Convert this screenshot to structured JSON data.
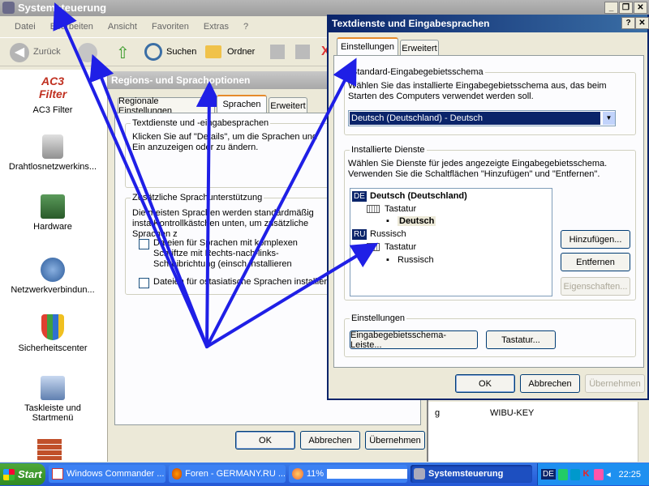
{
  "main_window": {
    "title": "Systemsteuerung",
    "menu": [
      "Datei",
      "Bearbeiten",
      "Ansicht",
      "Favoriten",
      "Extras",
      "?"
    ],
    "toolbar": {
      "back": "Zurück",
      "search": "Suchen",
      "folders": "Ordner"
    }
  },
  "sidebar": {
    "items": [
      {
        "label": "AC3 Filter",
        "icon": "ac3-filter-icon"
      },
      {
        "label": "Drahtlosnetzwerkins...",
        "icon": "wireless-network-icon"
      },
      {
        "label": "Hardware",
        "icon": "hardware-icon"
      },
      {
        "label": "Netzwerkverbindun...",
        "icon": "network-connections-icon"
      },
      {
        "label": "Sicherheitscenter",
        "icon": "security-center-icon"
      },
      {
        "label": "Taskleiste und Startmenü",
        "icon": "taskbar-icon"
      }
    ]
  },
  "regional_dialog": {
    "title": "Regions- und Sprachoptionen",
    "tabs": [
      "Regionale Einstellungen",
      "Sprachen",
      "Erweitert"
    ],
    "active_tab": "Sprachen",
    "group1_title": "Textdienste und -eingabesprachen",
    "group1_text": "Klicken Sie auf \"Details\", um die Sprachen und Ein anzuzeigen oder zu ändern.",
    "group2_title": "Zusätzliche Sprachunterstützung",
    "group2_text": "Die meisten Sprachen werden standardmäßig insta Kontrollkästchen unten, um zusätzliche Sprachen z",
    "checkbox1": "Dateien für Sprachen mit komplexen Schriftze mit Rechts-nach-links-Schreibrichtung (einsch installieren",
    "checkbox2": "Dateien für ostasiatische Sprachen installieren",
    "ok": "OK",
    "cancel": "Abbrechen",
    "apply": "Übernehmen"
  },
  "text_dialog": {
    "title": "Textdienste und Eingabesprachen",
    "help": "?",
    "close": "✕",
    "tabs": [
      "Einstellungen",
      "Erweitert"
    ],
    "std_group_title": "Standard-Eingabegebietsschema",
    "std_text": "Wählen Sie das installierte Eingabegebietsschema aus, das beim Starten des Computers verwendet werden soll.",
    "std_value": "Deutsch (Deutschland) - Deutsch",
    "installed_group_title": "Installierte Dienste",
    "installed_text": "Wählen Sie Dienste für jedes angezeigte Eingabegebietsschema. Verwenden Sie die Schaltflächen \"Hinzufügen\" und \"Entfernen\".",
    "tree": {
      "de_badge": "DE",
      "de_label": "Deutsch (Deutschland)",
      "de_kb": "Tastatur",
      "de_kb_item": "Deutsch",
      "ru_badge": "RU",
      "ru_label": "Russisch",
      "ru_kb": "Tastatur",
      "ru_kb_item": "Russisch"
    },
    "add": "Hinzufügen...",
    "remove": "Entfernen",
    "props": "Eigenschaften...",
    "settings_group_title": "Einstellungen",
    "langbar_btn": "Eingabegebietsschema-Leiste...",
    "keyboard_btn": "Tastatur...",
    "ok": "OK",
    "cancel": "Abbrechen",
    "apply": "Übernehmen"
  },
  "background_list": {
    "col1": "g",
    "col2": "WIBU-KEY"
  },
  "taskbar": {
    "start": "Start",
    "items": [
      "Windows Commander ...",
      "Foren - GERMANY.RU ...",
      "11%",
      "Systemsteuerung"
    ],
    "lang": "DE",
    "clock": "22:25"
  },
  "colors": {
    "title_blue": "#0a246a",
    "arrow": "#1f1fe6",
    "taskbar": "#2458d6"
  }
}
